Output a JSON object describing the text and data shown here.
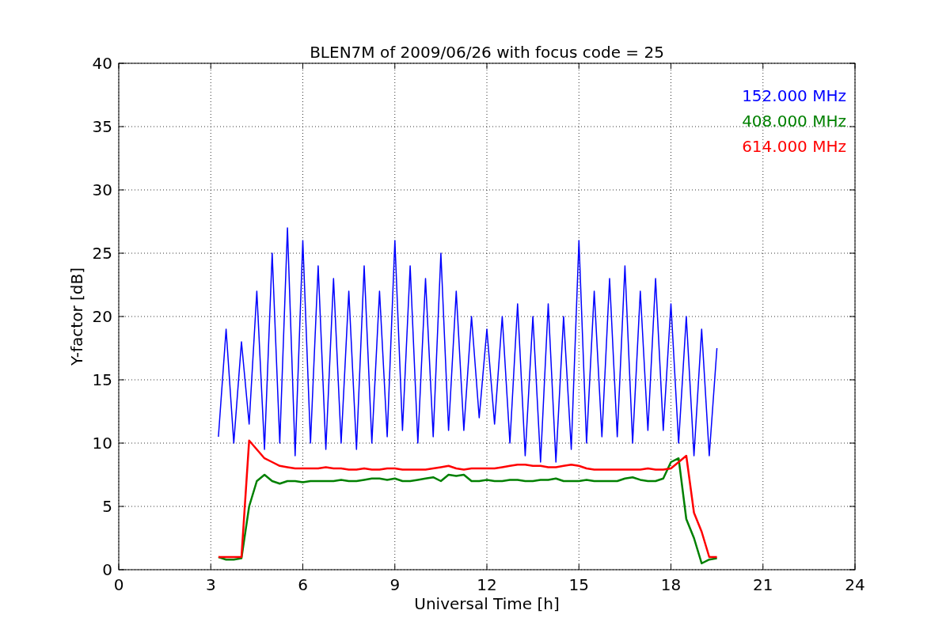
{
  "figure": {
    "chart_data": {
      "type": "line",
      "title": "BLEN7M of 2009/06/26 with focus code = 25",
      "xlabel": "Universal Time [h]",
      "ylabel": "Y-factor [dB]",
      "x": [
        3.25,
        3.5,
        3.75,
        4,
        4.25,
        4.5,
        4.75,
        5,
        5.25,
        5.5,
        5.75,
        6,
        6.25,
        6.5,
        6.75,
        7,
        7.25,
        7.5,
        7.75,
        8,
        8.25,
        8.5,
        8.75,
        9,
        9.25,
        9.5,
        9.75,
        10,
        10.25,
        10.5,
        10.75,
        11,
        11.25,
        11.5,
        11.75,
        12,
        12.25,
        12.5,
        12.75,
        13,
        13.25,
        13.5,
        13.75,
        14,
        14.25,
        14.5,
        14.75,
        15,
        15.25,
        15.5,
        15.75,
        16,
        16.25,
        16.5,
        16.75,
        17,
        17.25,
        17.5,
        17.75,
        18,
        18.25,
        18.5,
        18.75,
        19,
        19.25,
        19.5
      ],
      "series": [
        {
          "name": "152.000 MHz",
          "color": "#0000ff",
          "values": [
            10.5,
            19,
            10,
            18,
            11.5,
            22,
            9.5,
            25,
            10,
            27,
            9,
            26,
            10,
            24,
            9.5,
            23,
            10,
            22,
            9.5,
            24,
            10,
            22,
            10.5,
            26,
            11,
            24,
            10,
            23,
            10.5,
            25,
            11,
            22,
            11,
            20,
            12,
            19,
            11.5,
            20,
            10,
            21,
            9,
            20,
            8.5,
            21,
            8.5,
            20,
            9.5,
            26,
            10,
            22,
            10.5,
            23,
            10.5,
            24,
            10,
            22,
            11,
            23,
            11,
            21,
            10,
            20,
            9,
            19,
            9,
            17.5
          ]
        },
        {
          "name": "408.000 MHz",
          "color": "#008000",
          "values": [
            1,
            0.8,
            0.8,
            0.9,
            5,
            7,
            7.5,
            7,
            6.8,
            7,
            7,
            6.9,
            7,
            7,
            7,
            7,
            7.1,
            7,
            7,
            7.1,
            7.2,
            7.2,
            7.1,
            7.2,
            7,
            7,
            7.1,
            7.2,
            7.3,
            7,
            7.5,
            7.4,
            7.5,
            7,
            7,
            7.1,
            7,
            7,
            7.1,
            7.1,
            7,
            7,
            7.1,
            7.1,
            7.2,
            7,
            7,
            7,
            7.1,
            7,
            7,
            7,
            7,
            7.2,
            7.3,
            7.1,
            7,
            7,
            7.2,
            8.5,
            8.8,
            4,
            2.5,
            0.5,
            0.8,
            0.9
          ]
        },
        {
          "name": "614.000 MHz",
          "color": "#ff0000",
          "values": [
            1,
            1,
            1,
            1,
            10.2,
            9.5,
            8.8,
            8.5,
            8.2,
            8.1,
            8,
            8,
            8,
            8,
            8.1,
            8,
            8,
            7.9,
            7.9,
            8,
            7.9,
            7.9,
            8,
            8,
            7.9,
            7.9,
            7.9,
            7.9,
            8,
            8.1,
            8.2,
            8,
            7.9,
            8,
            8,
            8,
            8,
            8.1,
            8.2,
            8.3,
            8.3,
            8.2,
            8.2,
            8.1,
            8.1,
            8.2,
            8.3,
            8.2,
            8,
            7.9,
            7.9,
            7.9,
            7.9,
            7.9,
            7.9,
            7.9,
            8,
            7.9,
            7.9,
            8,
            8.5,
            9,
            4.5,
            3,
            1,
            1
          ]
        }
      ],
      "grid": true,
      "xlim": [
        0,
        24
      ],
      "ylim": [
        0,
        40
      ],
      "xticks": [
        0,
        3,
        6,
        9,
        12,
        15,
        18,
        21,
        24
      ],
      "yticks": [
        0,
        5,
        10,
        15,
        20,
        25,
        30,
        35,
        40
      ]
    }
  }
}
